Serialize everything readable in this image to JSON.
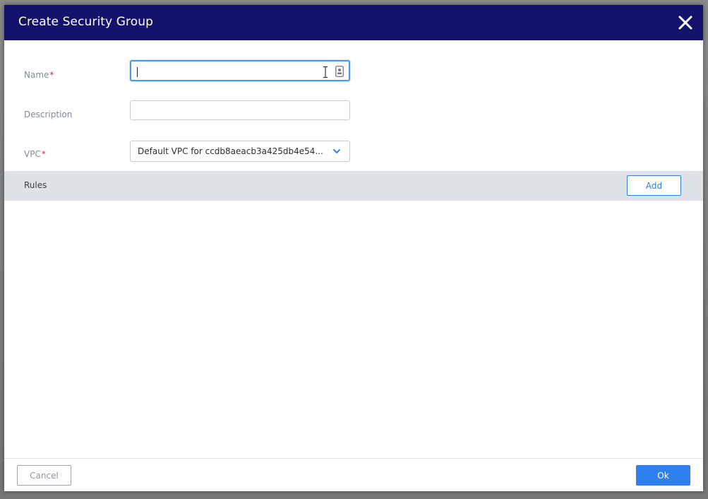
{
  "dialog": {
    "title": "Create Security Group",
    "close_icon": "close-icon"
  },
  "form": {
    "name": {
      "label": "Name",
      "required_mark": "*",
      "value": "",
      "placeholder": ""
    },
    "description": {
      "label": "Description",
      "value": "",
      "placeholder": ""
    },
    "vpc": {
      "label": "VPC",
      "required_mark": "*",
      "selected": "Default VPC for ccdb8aeacb3a425db4e54..."
    }
  },
  "rules": {
    "label": "Rules",
    "add_label": "Add"
  },
  "footer": {
    "cancel_label": "Cancel",
    "ok_label": "Ok"
  },
  "colors": {
    "header_bg": "#13136b",
    "accent": "#2f80ee",
    "required": "#e0284a",
    "rules_bar_bg": "#dfe3e8"
  }
}
